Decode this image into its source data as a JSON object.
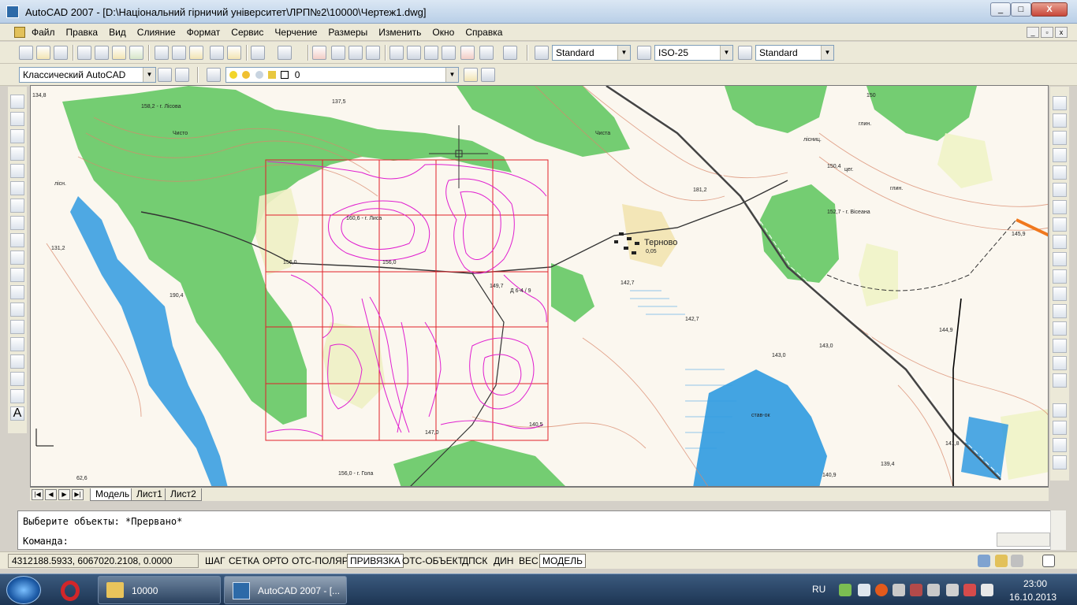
{
  "window": {
    "title": "AutoCAD 2007 - [D:\\Національний гірничий університет\\ЛРП№2\\10000\\Чертеж1.dwg]",
    "min": "_",
    "max": "□",
    "close": "X"
  },
  "menu": {
    "items": [
      "Файл",
      "Правка",
      "Вид",
      "Слияние",
      "Формат",
      "Сервис",
      "Черчение",
      "Размеры",
      "Изменить",
      "Окно",
      "Справка"
    ]
  },
  "toolbar": {
    "text_style": "Standard",
    "dim_style": "ISO-25",
    "table_style": "Standard",
    "workspace": "Классический AutoCAD",
    "layer": "0"
  },
  "map": {
    "labels": [
      "134,8",
      "158,2 - г. Лісова",
      "137,5",
      "Чисто",
      "150",
      "лісниц.",
      "глин.",
      "150,4",
      "цег.",
      "глин.",
      "181,2",
      "Терново",
      "0,05",
      "152,7 - г. Вісеана",
      "160,6 - г. Лиса",
      "156,0",
      "156,0",
      "149,7",
      "Д 6-4 / 9",
      "142,7",
      "142,7",
      "143,0",
      "144,9",
      "145,9",
      "140,5",
      "147,0",
      "156,0 - г. Гола",
      "141,8",
      "140,9",
      "139,4",
      "143,0",
      "190,4",
      "131,2",
      "62,6",
      "лісн.",
      "Чиста",
      "став-ок"
    ]
  },
  "tabs": {
    "model": "Модель",
    "sheet1": "Лист1",
    "sheet2": "Лист2"
  },
  "command": {
    "line1": "Выберите объекты: *Прервано*",
    "line2": "Команда:"
  },
  "status": {
    "coords": "4312188.5933, 6067020.2108, 0.0000",
    "buttons": [
      "ШАГ",
      "СЕТКА",
      "ОРТО",
      "ОТС-ПОЛЯР",
      "ПРИВЯЗКА",
      "ОТС-ОБЪЕКТ",
      "ДПСК",
      "ДИН",
      "ВЕС",
      "МОДЕЛЬ"
    ]
  },
  "taskbar": {
    "folder": "10000",
    "autocad": "AutoCAD 2007 - [...",
    "lang": "RU",
    "time": "23:00",
    "date": "16.10.2013"
  },
  "colors": {
    "forest": "#5cc55c",
    "contour": "#d9876a",
    "water": "#2f9ae0",
    "grid": "#e0202a",
    "isoline": "#e01ecf"
  }
}
